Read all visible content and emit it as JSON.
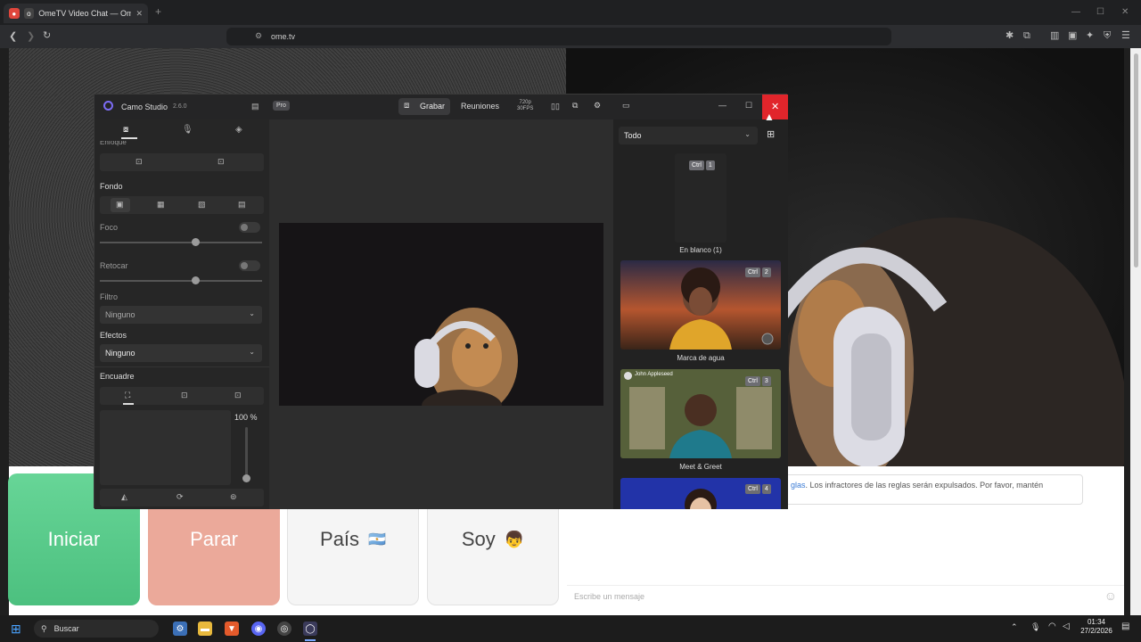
{
  "browser": {
    "tab_title": "OmeTV Video Chat — Omeg…",
    "url": "ome.tv",
    "new_tab": "+"
  },
  "page": {
    "start_label": "Iniciar",
    "stop_label": "Parar",
    "country_label": "País",
    "country_flag": "🇦🇷",
    "gender_label": "Soy",
    "gender_emoji": "👦",
    "notice_link": "glas",
    "notice_text": ". Los infractores de las reglas serán expulsados. Por favor, mantén",
    "message_placeholder": "Escribe un mensaje",
    "colors": {
      "start": "#5fd08b",
      "stop": "#eba99a"
    }
  },
  "camo": {
    "app_name": "Camo Studio",
    "version": "2.6.0",
    "pro_badge": "Pro",
    "record_label": "Grabar",
    "meetings_label": "Reuniones",
    "resolution": "720p",
    "fps": "30FPS",
    "left": {
      "section_top_partial": "Enfoque",
      "background_label": "Fondo",
      "focus_label": "Foco",
      "retouch_label": "Retocar",
      "filter_label": "Filtro",
      "filter_value": "Ninguno",
      "effects_label": "Efectos",
      "effects_value": "Ninguno",
      "framing_label": "Encuadre",
      "zoom_value": "100 %",
      "focus_level": 0.6,
      "retouch_level": 0.6,
      "zoom_level": 0.0
    },
    "right": {
      "filter_value": "Todo",
      "overlays": [
        {
          "caption": "En blanco (1)",
          "ctrl": "Ctrl",
          "key": "1"
        },
        {
          "caption": "Marca de agua",
          "ctrl": "Ctrl",
          "key": "2"
        },
        {
          "caption": "Meet & Greet",
          "ctrl": "Ctrl",
          "key": "3",
          "name": "John Appleseed"
        },
        {
          "caption": "",
          "ctrl": "Ctrl",
          "key": "4"
        }
      ]
    }
  },
  "taskbar": {
    "search_label": "Buscar",
    "time": "01:34",
    "date": "27/2/2026"
  }
}
